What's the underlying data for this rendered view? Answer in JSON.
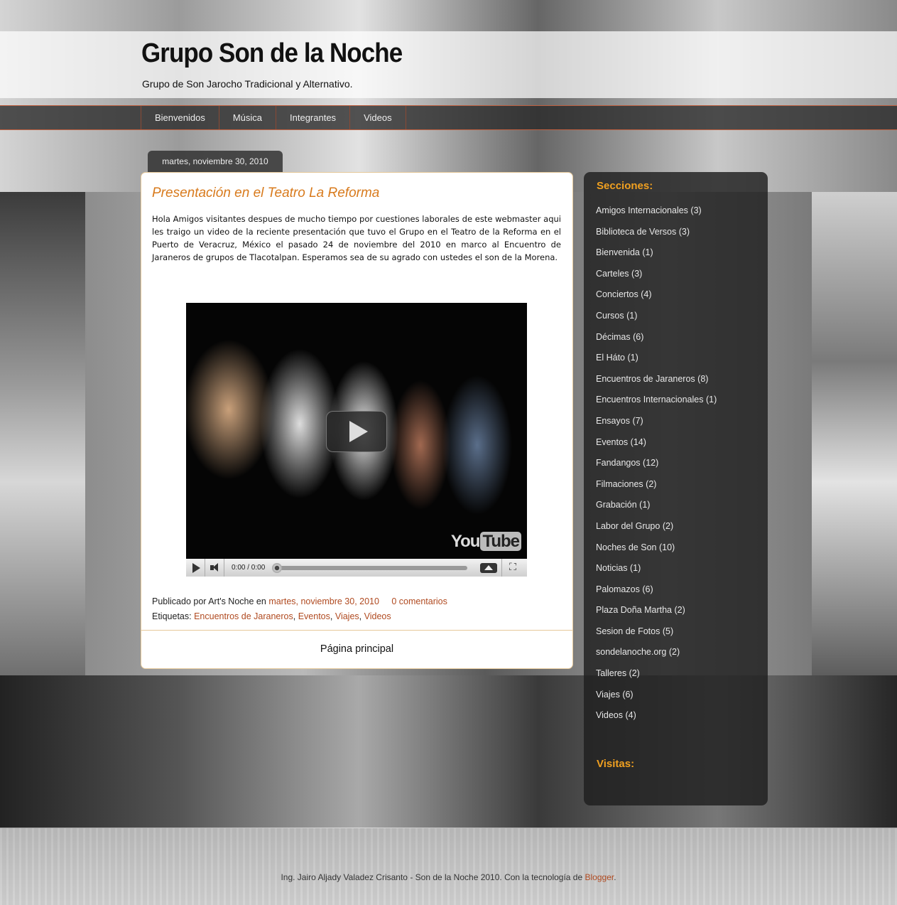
{
  "header": {
    "title": "Grupo Son de la Noche",
    "description": "Grupo de Son Jarocho Tradicional y Alternativo."
  },
  "nav": {
    "items": [
      "Bienvenidos",
      "Música",
      "Integrantes",
      "Videos"
    ]
  },
  "post": {
    "date": "martes, noviembre 30, 2010",
    "title": "Presentación en el Teatro La Reforma",
    "body": "Hola Amigos visitantes despues de mucho tiempo por cuestiones laborales de este webmaster aqui les traigo un video de la reciente presentación que tuvo el Grupo en el Teatro de la Reforma en el Puerto de Veracruz, México el pasado 24 de noviembre del 2010 en marco al Encuentro de Jaraneros de grupos de Tlacotalpan. Esperamos sea de su agrado con ustedes el son de la Morena.",
    "video": {
      "time": "0:00 / 0:00",
      "logo_you": "You",
      "logo_tube": "Tube"
    },
    "footer": {
      "published_by": "Publicado por Art's Noche en",
      "date_link": "martes, noviembre 30, 2010",
      "comments_link": "0 comentarios",
      "labels_prefix": "Etiquetas:",
      "labels": [
        "Encuentros de Jaraneros",
        "Eventos",
        "Viajes",
        "Videos"
      ]
    },
    "home_link": "Página principal"
  },
  "sidebar": {
    "sections_title": "Secciones:",
    "sections": [
      {
        "label": "Amigos Internacionales",
        "count": "(3)"
      },
      {
        "label": "Biblioteca de Versos",
        "count": "(3)"
      },
      {
        "label": "Bienvenida",
        "count": "(1)"
      },
      {
        "label": "Carteles",
        "count": "(3)"
      },
      {
        "label": "Conciertos",
        "count": "(4)"
      },
      {
        "label": "Cursos",
        "count": "(1)"
      },
      {
        "label": "Décimas",
        "count": "(6)"
      },
      {
        "label": "El Háto",
        "count": "(1)"
      },
      {
        "label": "Encuentros de Jaraneros",
        "count": "(8)"
      },
      {
        "label": "Encuentros Internacionales",
        "count": "(1)"
      },
      {
        "label": "Ensayos",
        "count": "(7)"
      },
      {
        "label": "Eventos",
        "count": "(14)"
      },
      {
        "label": "Fandangos",
        "count": "(12)"
      },
      {
        "label": "Filmaciones",
        "count": "(2)"
      },
      {
        "label": "Grabación",
        "count": "(1)"
      },
      {
        "label": "Labor del Grupo",
        "count": "(2)"
      },
      {
        "label": "Noches de Son",
        "count": "(10)"
      },
      {
        "label": "Noticias",
        "count": "(1)"
      },
      {
        "label": "Palomazos",
        "count": "(6)"
      },
      {
        "label": "Plaza Doña Martha",
        "count": "(2)"
      },
      {
        "label": "Sesion de Fotos",
        "count": "(5)"
      },
      {
        "label": "sondelanoche.org",
        "count": "(2)"
      },
      {
        "label": "Talleres",
        "count": "(2)"
      },
      {
        "label": "Viajes",
        "count": "(6)"
      },
      {
        "label": "Videos",
        "count": "(4)"
      }
    ],
    "visits_title": "Visitas:"
  },
  "footer": {
    "text": "Ing. Jairo Aljady Valadez Crisanto - Son de la Noche 2010. Con la tecnología de",
    "link": "Blogger",
    "end": "."
  },
  "colors": {
    "accent_orange": "#d87a1c",
    "link": "#b04a20",
    "sidebar_title": "#f0a020"
  }
}
